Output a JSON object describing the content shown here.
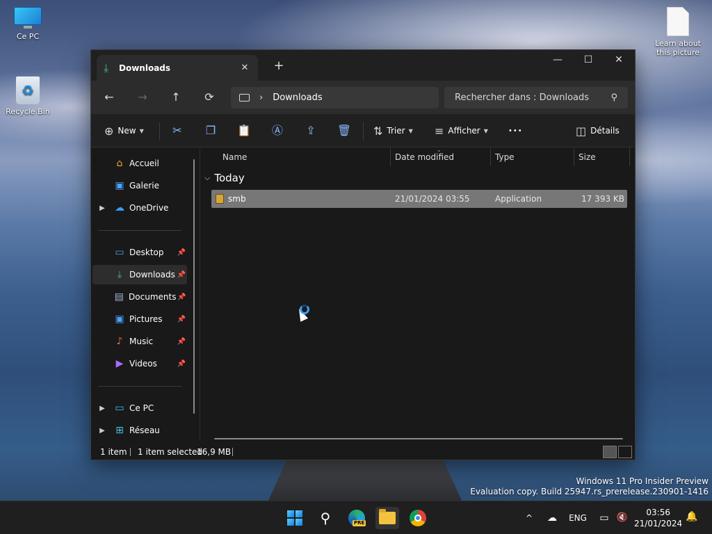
{
  "desktop": {
    "icons": [
      {
        "label": "Ce PC",
        "icon": "computer-icon"
      },
      {
        "label": "Recycle Bin",
        "icon": "recycle-bin-icon"
      },
      {
        "label": "Learn about this picture",
        "icon": "file-icon"
      }
    ]
  },
  "window": {
    "tab_title": "Downloads",
    "tab_close": "✕",
    "new_tab": "+",
    "controls": {
      "minimize": "—",
      "maximize": "☐",
      "close": "✕"
    }
  },
  "navbar": {
    "back": "←",
    "forward": "→",
    "up": "↑",
    "refresh": "⟳",
    "breadcrumb_separator": "›",
    "location": "Downloads",
    "search_placeholder": "Rechercher dans : Downloads",
    "search_icon": "⚲"
  },
  "toolbar": {
    "new_label": "New",
    "sort_label": "Trier",
    "view_label": "Afficher",
    "more": "•••",
    "details_label": "Détails",
    "icons": [
      "cut-icon",
      "copy-icon",
      "paste-icon",
      "rename-icon",
      "share-icon",
      "delete-icon"
    ]
  },
  "sidebar": {
    "items": [
      {
        "label": "Accueil",
        "icon": "home-icon",
        "expandable": false,
        "pinned": false
      },
      {
        "label": "Galerie",
        "icon": "gallery-icon",
        "expandable": false,
        "pinned": false
      },
      {
        "label": "OneDrive",
        "icon": "cloud-icon",
        "expandable": true,
        "pinned": false
      },
      {
        "label": "Desktop",
        "icon": "desktop-icon",
        "expandable": false,
        "pinned": true
      },
      {
        "label": "Downloads",
        "icon": "download-icon",
        "expandable": false,
        "pinned": true,
        "selected": true
      },
      {
        "label": "Documents",
        "icon": "document-icon",
        "expandable": false,
        "pinned": true
      },
      {
        "label": "Pictures",
        "icon": "pictures-icon",
        "expandable": false,
        "pinned": true
      },
      {
        "label": "Music",
        "icon": "music-icon",
        "expandable": false,
        "pinned": true
      },
      {
        "label": "Videos",
        "icon": "videos-icon",
        "expandable": false,
        "pinned": true
      },
      {
        "label": "Ce PC",
        "icon": "computer-icon",
        "expandable": true,
        "pinned": false
      },
      {
        "label": "Réseau",
        "icon": "network-icon",
        "expandable": true,
        "pinned": false
      }
    ]
  },
  "filelist": {
    "columns": [
      "Name",
      "Date modified",
      "Type",
      "Size"
    ],
    "group": "Today",
    "rows": [
      {
        "name": "smb",
        "date": "21/01/2024 03:55",
        "type": "Application",
        "size": "17 393 KB",
        "selected": true
      }
    ]
  },
  "statusbar": {
    "count": "1 item",
    "selected": "1 item selected",
    "size": "16,9 MB"
  },
  "watermark": {
    "line1": "Windows 11 Pro Insider Preview",
    "line2": "Evaluation copy. Build 25947.rs_prerelease.230901-1416"
  },
  "taskbar": {
    "apps": [
      "start-icon",
      "search-icon",
      "edge-beta-icon",
      "file-explorer-icon",
      "chrome-icon"
    ],
    "edge_badge": "PRE",
    "tray_chevron": "^",
    "language": "ENG",
    "time": "03:56",
    "date": "21/01/2024"
  },
  "colors": {
    "accent": "#3aa0ff",
    "window_bg": "#191919",
    "selected_row": "#777777",
    "download_green": "#3ec07a"
  }
}
